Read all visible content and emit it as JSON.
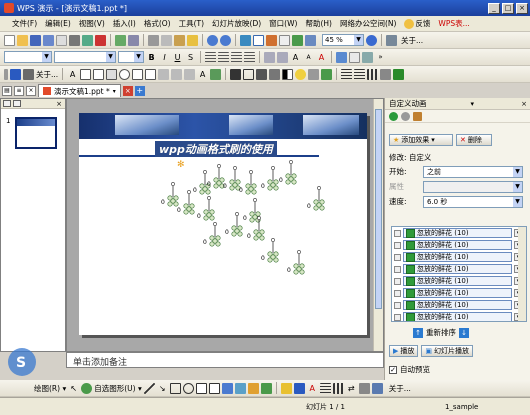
{
  "window": {
    "title": "WPS 演示 - [演示文稿1.ppt *]",
    "controls": [
      "_",
      "□",
      "×"
    ]
  },
  "menu": {
    "items": [
      "文件(F)",
      "编辑(E)",
      "视图(V)",
      "插入(I)",
      "格式(O)",
      "工具(T)",
      "幻灯片放映(D)",
      "窗口(W)",
      "帮助(H)",
      "网络办公空间(N)"
    ],
    "feedback": "反馈",
    "wps": "WPS表..."
  },
  "toolbar1": {
    "zoom": "45 %",
    "about": "关于..."
  },
  "toolbar3": {
    "about": "关于..."
  },
  "tabs": {
    "doc_tab": "演示文稿1.ppt *"
  },
  "slides_panel": {
    "slide_number": "1"
  },
  "slide": {
    "title": "wpp动画格式刷的使用",
    "zero_labels": [
      "0",
      "0",
      "0",
      "0",
      "0",
      "0",
      "0",
      "0",
      "0",
      "0",
      "0",
      "0",
      "0",
      "0",
      "0",
      "0"
    ]
  },
  "notes": {
    "placeholder": "单击添加备注"
  },
  "drawbar": {
    "draw_label": "绘图(R) ▾",
    "autoshape_label": "自选图形(U) ▾",
    "about": "关于..."
  },
  "status": {
    "slide_indicator": "幻灯片 1 / 1",
    "template": "1_sample"
  },
  "taskpane": {
    "title": "自定义动画",
    "add_effect": "添加效果",
    "delete": "删除",
    "modify_label": "修改: 自定义",
    "start_label": "开始:",
    "start_value": "之前",
    "property_label": "属性",
    "speed_label": "速度:",
    "speed_value": "6.0 秒",
    "anim_items": [
      "忽放的鲜花 (10)",
      "忽放的鲜花 (10)",
      "忽放的鲜花 (10)",
      "忽放的鲜花 (10)",
      "忽放的鲜花 (10)",
      "忽放的鲜花 (10)",
      "忽放的鲜花 (10)",
      "忽放的鲜花 (10)"
    ],
    "reorder": "重新排序",
    "play": "播放",
    "slideshow": "幻灯片播放",
    "autopreview": "自动预览"
  },
  "colors": {
    "titlebar": "#1b3f9c",
    "banner": "#16306d",
    "anim_icon": "#2f9a3a"
  }
}
